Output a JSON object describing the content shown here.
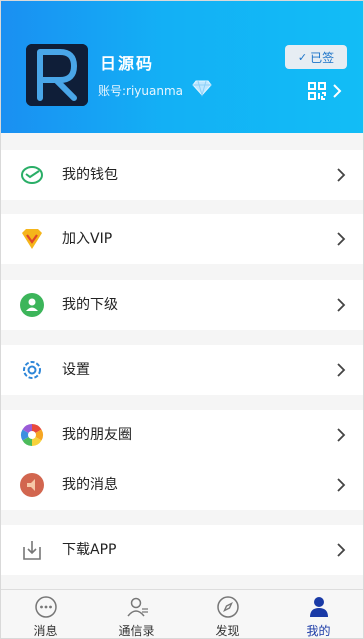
{
  "profile": {
    "nickname": "日源码",
    "account": "账号:riyuanma",
    "signed_label": "已签",
    "signed_check": "✓"
  },
  "menu": [
    {
      "label": "我的钱包",
      "icon": "wallet-icon"
    },
    {
      "label": "加入VIP",
      "icon": "vip-icon"
    },
    {
      "label": "我的下级",
      "icon": "user-icon"
    },
    {
      "label": "设置",
      "icon": "gear-icon"
    },
    {
      "label": "我的朋友圈",
      "icon": "moments-icon"
    },
    {
      "label": "我的消息",
      "icon": "message-icon"
    },
    {
      "label": "下载APP",
      "icon": "download-icon"
    }
  ],
  "tabs": [
    {
      "label": "消息",
      "icon": "chat-icon",
      "active": false
    },
    {
      "label": "通信录",
      "icon": "contacts-icon",
      "active": false
    },
    {
      "label": "发现",
      "icon": "compass-icon",
      "active": false
    },
    {
      "label": "我的",
      "icon": "person-icon",
      "active": true
    }
  ],
  "colors": {
    "header_start": "#1a8ff2",
    "header_end": "#12bdf6",
    "active_tab": "#1a3aa6"
  }
}
